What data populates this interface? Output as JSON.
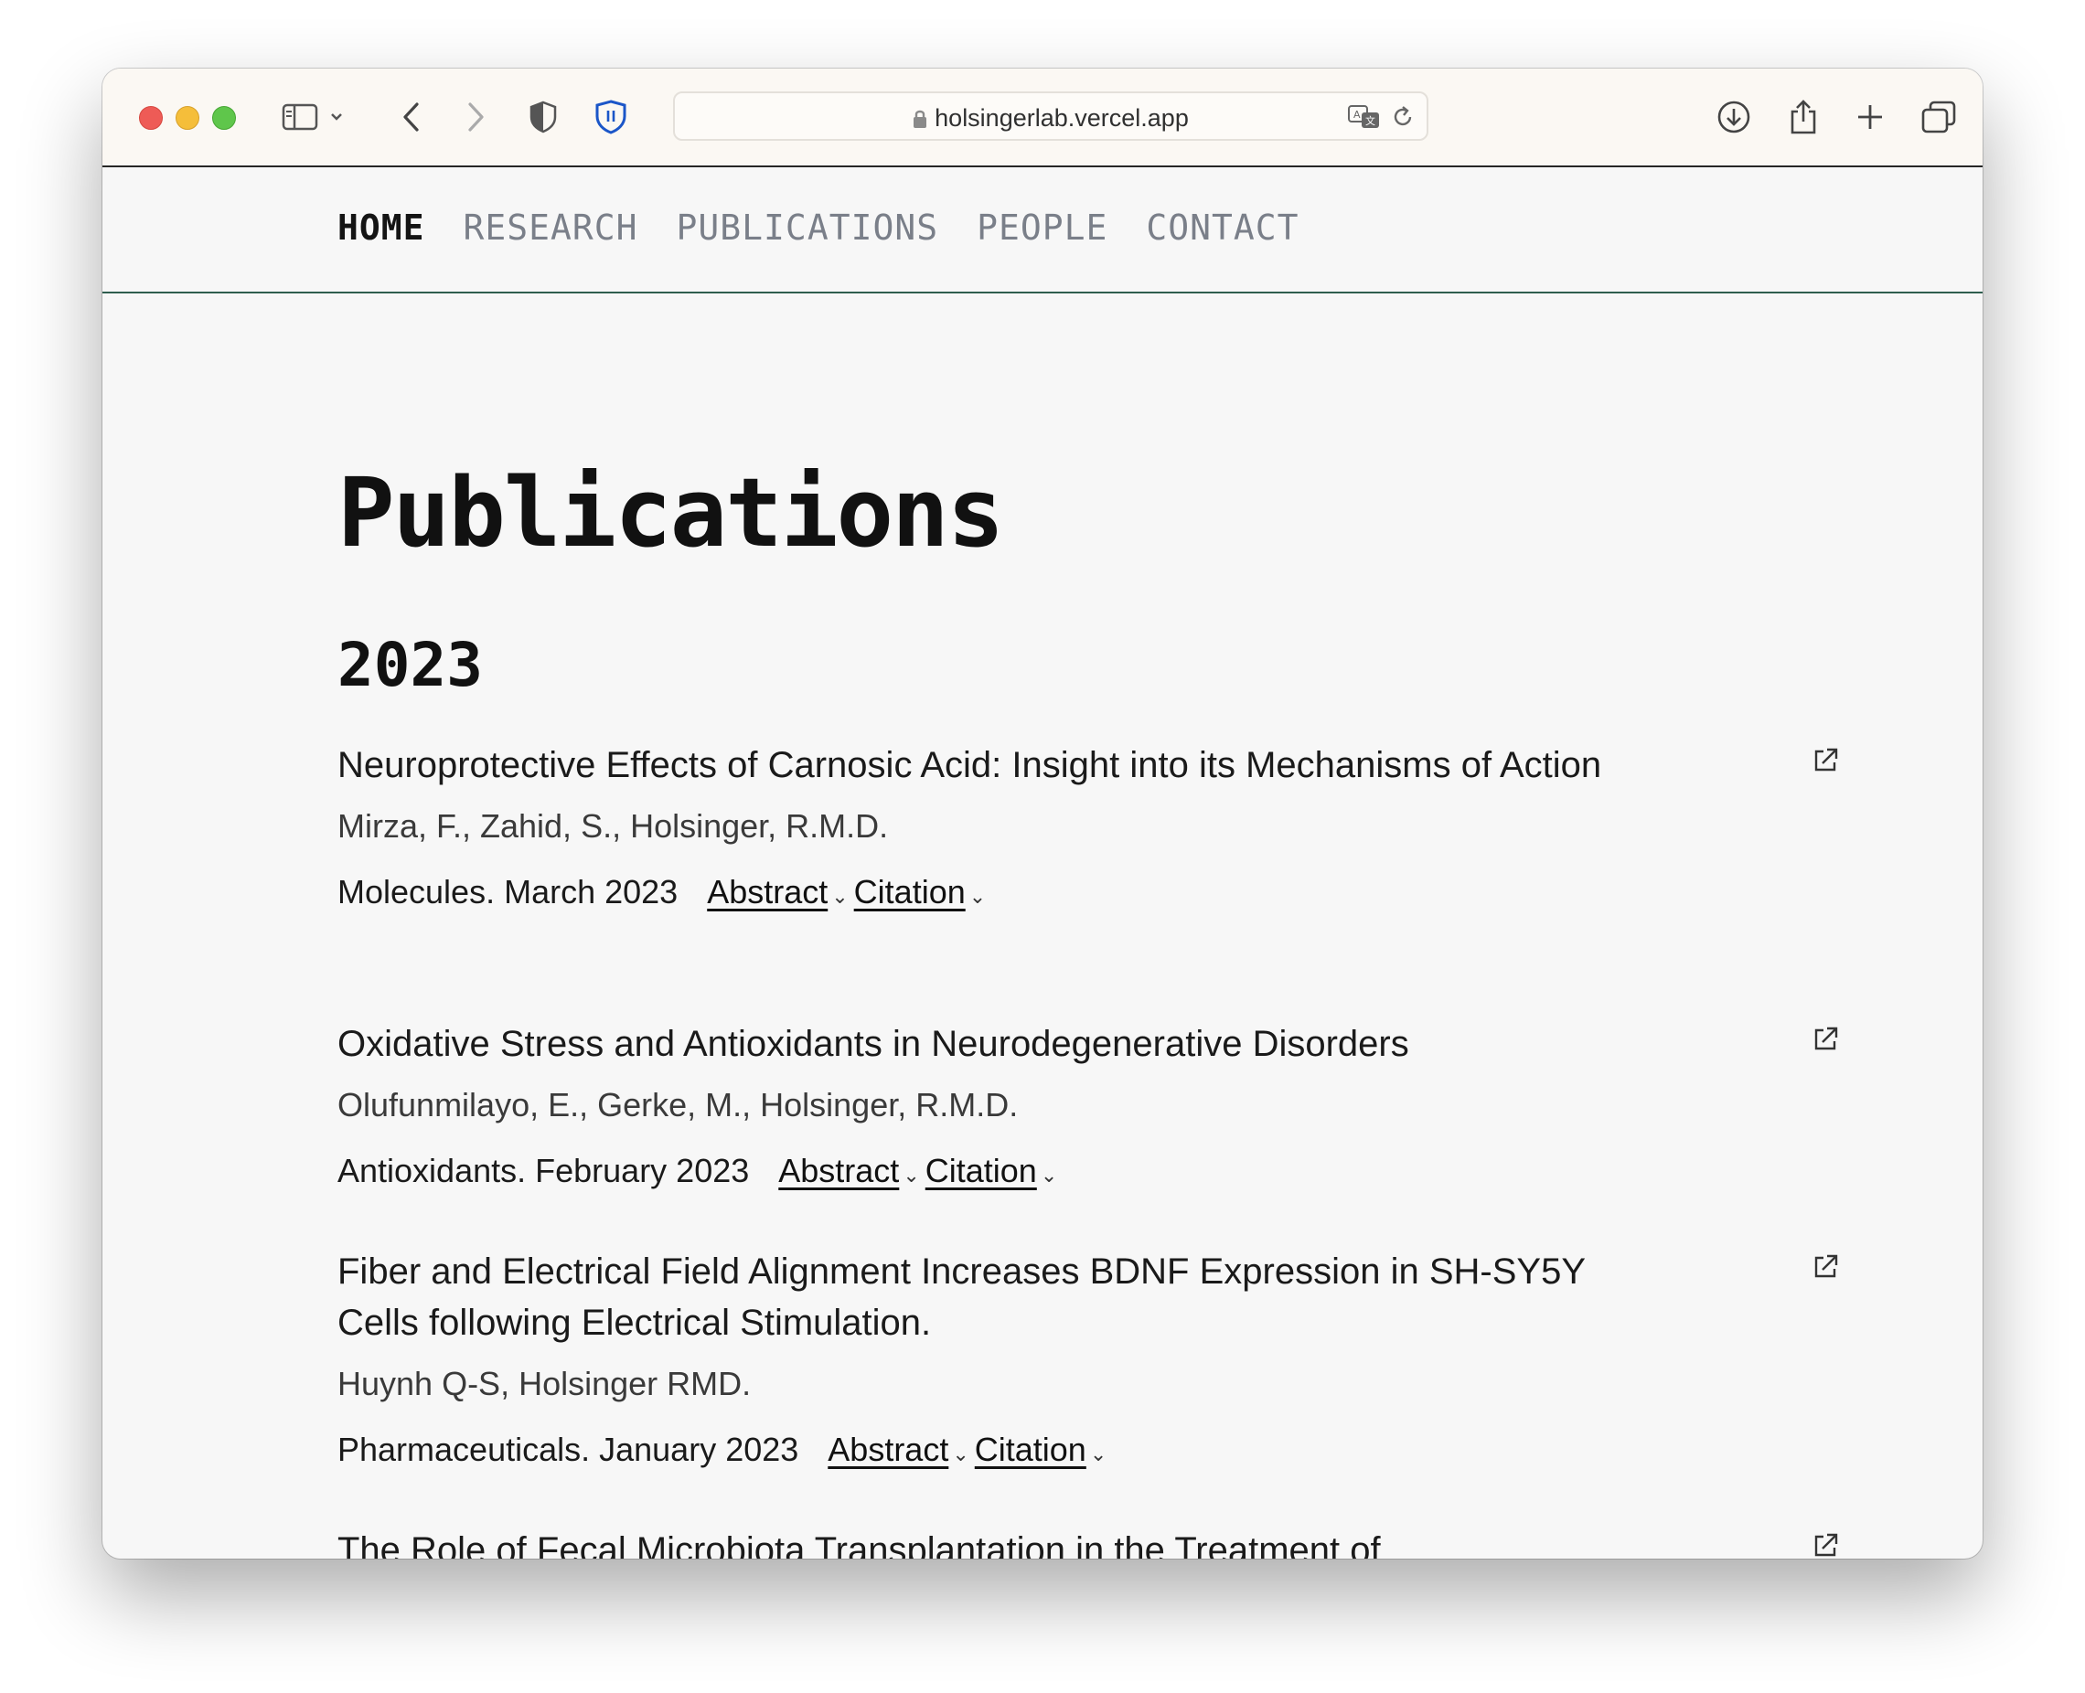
{
  "browser": {
    "url": "holsingerlab.vercel.app"
  },
  "nav": {
    "items": [
      {
        "label": "HOME",
        "active": true
      },
      {
        "label": "RESEARCH",
        "active": false
      },
      {
        "label": "PUBLICATIONS",
        "active": false
      },
      {
        "label": "PEOPLE",
        "active": false
      },
      {
        "label": "CONTACT",
        "active": false
      }
    ]
  },
  "page": {
    "title": "Publications",
    "year": "2023"
  },
  "publications": [
    {
      "title": "Neuroprotective Effects of Carnosic Acid: Insight into its Mechanisms of Action",
      "authors": "Mirza, F., Zahid, S., Holsinger, R.M.D.",
      "venue": "Molecules. March 2023",
      "abstract_label": "Abstract",
      "citation_label": "Citation"
    },
    {
      "title": "Oxidative Stress and Antioxidants in Neurodegenerative Disorders",
      "authors": "Olufunmilayo, E., Gerke, M., Holsinger, R.M.D.",
      "venue": "Antioxidants. February 2023",
      "abstract_label": "Abstract",
      "citation_label": "Citation"
    },
    {
      "title": "Fiber and Electrical Field Alignment Increases BDNF Expression in SH-SY5Y Cells following Electrical Stimulation.",
      "authors": "Huynh Q-S, Holsinger RMD.",
      "venue": "Pharmaceuticals. January 2023",
      "abstract_label": "Abstract",
      "citation_label": "Citation"
    },
    {
      "title": "The Role of Fecal Microbiota Transplantation in the Treatment of Neurodegenerative Diseases: A Review",
      "authors": "",
      "venue": "",
      "abstract_label": "",
      "citation_label": ""
    }
  ]
}
